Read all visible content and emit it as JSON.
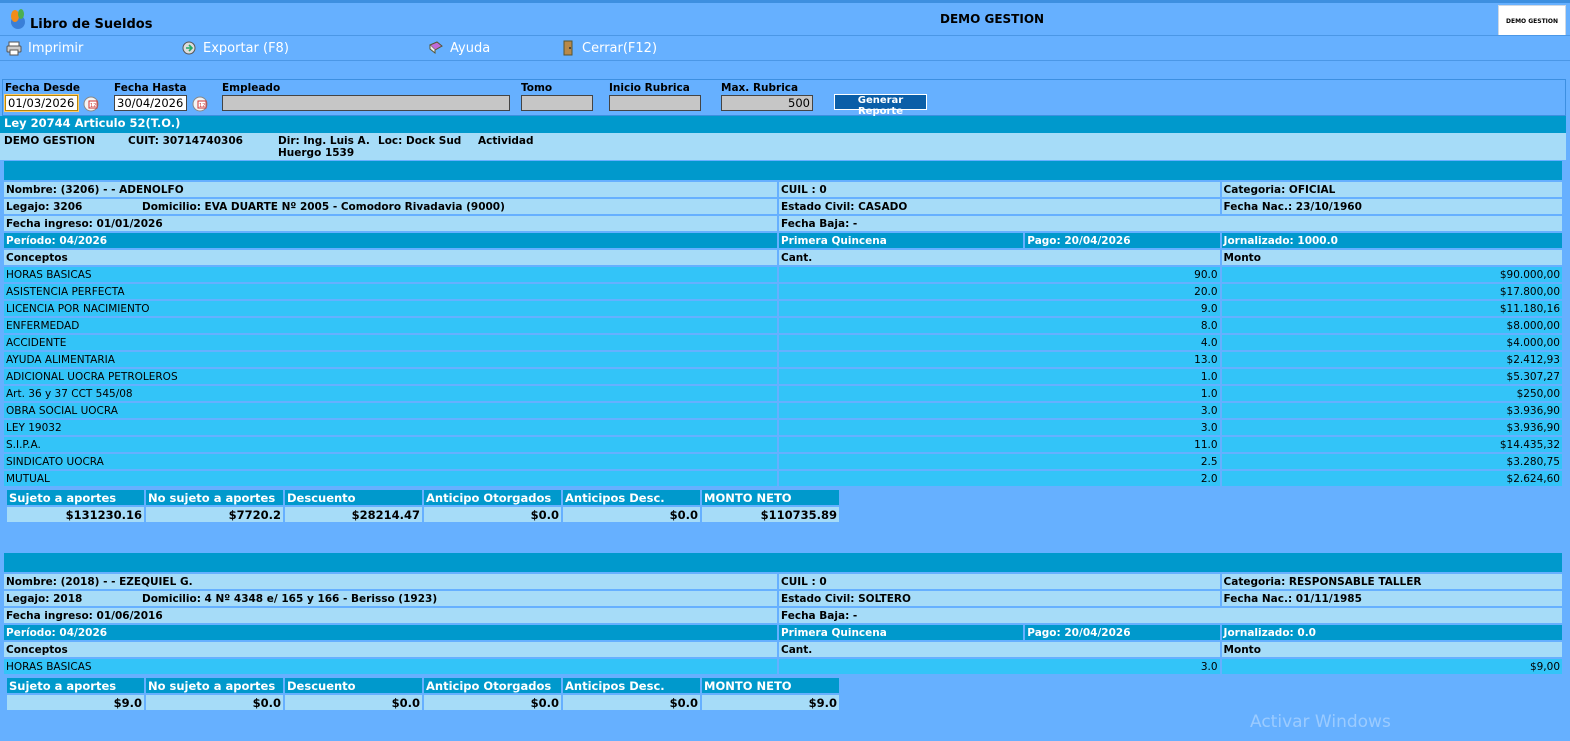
{
  "app": {
    "title": "Libro de Sueldos",
    "company_header": "DEMO GESTION",
    "logo_text": "DEMO GESTION"
  },
  "toolbar": {
    "print": "Imprimir",
    "export": "Exportar (F8)",
    "help": "Ayuda",
    "close": "Cerrar(F12)"
  },
  "filters": {
    "fecha_desde_label": "Fecha Desde",
    "fecha_desde": "01/03/2026",
    "fecha_hasta_label": "Fecha Hasta",
    "fecha_hasta": "30/04/2026",
    "empleado_label": "Empleado",
    "empleado": "",
    "tomo_label": "Tomo",
    "tomo": "",
    "inicio_label": "Inicio Rubrica",
    "inicio": "",
    "max_label": "Max. Rubrica",
    "max": "500",
    "generate": "Generar Reporte"
  },
  "law": "Ley 20744 Articulo 52(T.O.)",
  "company": {
    "name": "DEMO GESTION",
    "cuit": "CUIT: 30714740306",
    "dir1": "Dir: Ing. Luis A.",
    "dir2": "Huergo 1539",
    "loc": "Loc: Dock Sud",
    "actividad": "Actividad"
  },
  "employees": [
    {
      "nombre": "Nombre: (3206) - - ADENOLFO",
      "cuil": "CUIL : 0",
      "categoria": "Categoria: OFICIAL",
      "legajo": "Legajo: 3206",
      "domicilio": "Domicilio: EVA DUARTE Nº 2005 - Comodoro Rivadavia (9000)",
      "estado_civil": "Estado Civil: CASADO",
      "fecha_nac": "Fecha Nac.: 23/10/1960",
      "fecha_ingreso": "Fecha ingreso: 01/01/2026",
      "fecha_baja": "Fecha Baja: -",
      "periodo": "Período:  04/2026",
      "quincena": "Primera Quincena",
      "pago": "Pago: 20/04/2026",
      "jornalizado": "Jornalizado: 1000.0",
      "col_conceptos": "Conceptos",
      "col_cant": "Cant.",
      "col_monto": "Monto",
      "conceptos": [
        {
          "name": "HORAS BASICAS",
          "cant": "90.0",
          "monto": "$90.000,00"
        },
        {
          "name": "ASISTENCIA PERFECTA",
          "cant": "20.0",
          "monto": "$17.800,00"
        },
        {
          "name": "LICENCIA POR NACIMIENTO",
          "cant": "9.0",
          "monto": "$11.180,16"
        },
        {
          "name": "ENFERMEDAD",
          "cant": "8.0",
          "monto": "$8.000,00"
        },
        {
          "name": "ACCIDENTE",
          "cant": "4.0",
          "monto": "$4.000,00"
        },
        {
          "name": "AYUDA ALIMENTARIA",
          "cant": "13.0",
          "monto": "$2.412,93"
        },
        {
          "name": "ADICIONAL UOCRA PETROLEROS",
          "cant": "1.0",
          "monto": "$5.307,27"
        },
        {
          "name": "Art. 36 y 37 CCT 545/08",
          "cant": "1.0",
          "monto": "$250,00"
        },
        {
          "name": "OBRA SOCIAL UOCRA",
          "cant": "3.0",
          "monto": "$3.936,90"
        },
        {
          "name": "LEY 19032",
          "cant": "3.0",
          "monto": "$3.936,90"
        },
        {
          "name": "S.I.P.A.",
          "cant": "11.0",
          "monto": "$14.435,32"
        },
        {
          "name": "SINDICATO UOCRA",
          "cant": "2.5",
          "monto": "$3.280,75"
        },
        {
          "name": "MUTUAL",
          "cant": "2.0",
          "monto": "$2.624,60"
        }
      ],
      "totals_headers": [
        "Sujeto a aportes",
        "No sujeto a aportes",
        "Descuento",
        "Anticipo Otorgados",
        "Anticipos Desc.",
        "MONTO NETO"
      ],
      "totals": [
        "$131230.16",
        "$7720.2",
        "$28214.47",
        "$0.0",
        "$0.0",
        "$110735.89"
      ]
    },
    {
      "nombre": "Nombre: (2018) - - EZEQUIEL G.",
      "cuil": "CUIL : 0",
      "categoria": "Categoria: RESPONSABLE TALLER",
      "legajo": "Legajo: 2018",
      "domicilio": "Domicilio: 4 Nº 4348 e/ 165 y 166 - Berisso (1923)",
      "estado_civil": "Estado Civil: SOLTERO",
      "fecha_nac": "Fecha Nac.: 01/11/1985",
      "fecha_ingreso": "Fecha ingreso: 01/06/2016",
      "fecha_baja": "Fecha Baja: -",
      "periodo": "Período:  04/2026",
      "quincena": "Primera Quincena",
      "pago": "Pago: 20/04/2026",
      "jornalizado": "Jornalizado: 0.0",
      "col_conceptos": "Conceptos",
      "col_cant": "Cant.",
      "col_monto": "Monto",
      "conceptos": [
        {
          "name": "HORAS BASICAS",
          "cant": "3.0",
          "monto": "$9,00"
        }
      ],
      "totals_headers": [
        "Sujeto a aportes",
        "No sujeto a aportes",
        "Descuento",
        "Anticipo Otorgados",
        "Anticipos Desc.",
        "MONTO NETO"
      ],
      "totals": [
        "$9.0",
        "$0.0",
        "$0.0",
        "$0.0",
        "$0.0",
        "$9.0"
      ]
    }
  ],
  "watermark": "Activar Windows",
  "colors": {
    "page_bg": "#66b0ff",
    "band": "#0099cc",
    "light_row": "#a6dcf8",
    "concept_row": "#33c4f8"
  }
}
